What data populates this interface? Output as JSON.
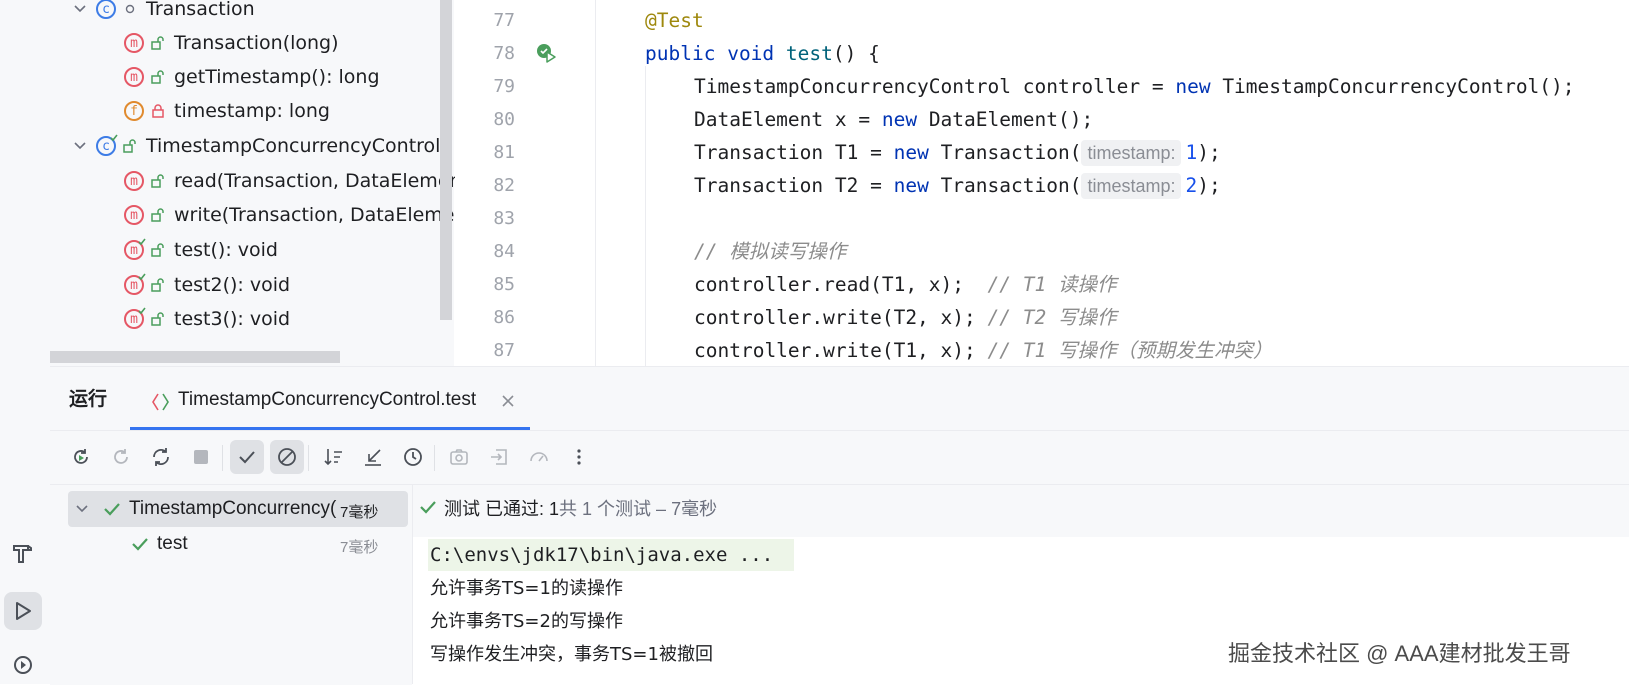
{
  "structure": {
    "items": [
      {
        "label": "Transaction",
        "kind": "class"
      },
      {
        "label": "Transaction(long)",
        "kind": "method"
      },
      {
        "label": "getTimestamp(): long",
        "kind": "method"
      },
      {
        "label": "timestamp: long",
        "kind": "field"
      },
      {
        "label": "TimestampConcurrencyControl",
        "kind": "class"
      },
      {
        "label": "read(Transaction, DataElement)",
        "kind": "method"
      },
      {
        "label": "write(Transaction, DataElement)",
        "kind": "method"
      },
      {
        "label": "test(): void",
        "kind": "test-method"
      },
      {
        "label": "test2(): void",
        "kind": "test-method"
      },
      {
        "label": "test3(): void",
        "kind": "test-method"
      }
    ]
  },
  "editor": {
    "line_numbers": [
      "77",
      "78",
      "79",
      "80",
      "81",
      "82",
      "83",
      "84",
      "85",
      "86",
      "87"
    ],
    "lines": {
      "l77": "@Test",
      "l78_kw1": "public",
      "l78_kw2": "void",
      "l78_fn": "test",
      "l78_rest": "() {",
      "l79_a": "TimestampConcurrencyControl controller = ",
      "l79_kw": "new",
      "l79_b": " TimestampConcurrencyControl();",
      "l80_a": "DataElement x = ",
      "l80_kw": "new",
      "l80_b": " DataElement();",
      "l81_a": "Transaction T1 = ",
      "l81_kw": "new",
      "l81_b": " Transaction(",
      "l81_hint": "timestamp:",
      "l81_num": "1",
      "l81_c": ");",
      "l82_a": "Transaction T2 = ",
      "l82_kw": "new",
      "l82_b": " Transaction(",
      "l82_hint": "timestamp:",
      "l82_num": "2",
      "l82_c": ");",
      "l84_cmt": "// 模拟读写操作",
      "l85_a": "controller.read(T1, x);  ",
      "l85_cmt": "// T1 读操作",
      "l86_a": "controller.write(T2, x); ",
      "l86_cmt": "// T2 写操作",
      "l87_a": "controller.write(T1, x); ",
      "l87_cmt": "// T1 写操作（预期发生冲突）"
    }
  },
  "run": {
    "title": "运行",
    "tab_label": "TimestampConcurrencyControl.test",
    "status_label": "测试 已通过:",
    "status_count": "1",
    "status_total": "共 1 个测试 – 7毫秒",
    "tree": [
      {
        "label": "TimestampConcurrency(",
        "time": "7毫秒"
      },
      {
        "label": "test",
        "time": "7毫秒"
      }
    ],
    "console": [
      "C:\\envs\\jdk17\\bin\\java.exe ...",
      "允许事务TS=1的读操作",
      "允许事务TS=2的写操作",
      "写操作发生冲突，事务TS=1被撤回"
    ]
  },
  "watermark": "掘金技术社区 @ AAA建材批发王哥",
  "colors": {
    "accent": "#3574f0",
    "success": "#4a9e5c",
    "keyword": "#0033b3",
    "annotation": "#9e880d",
    "method_icon": "#e55765",
    "class_icon": "#3d7ce6"
  }
}
